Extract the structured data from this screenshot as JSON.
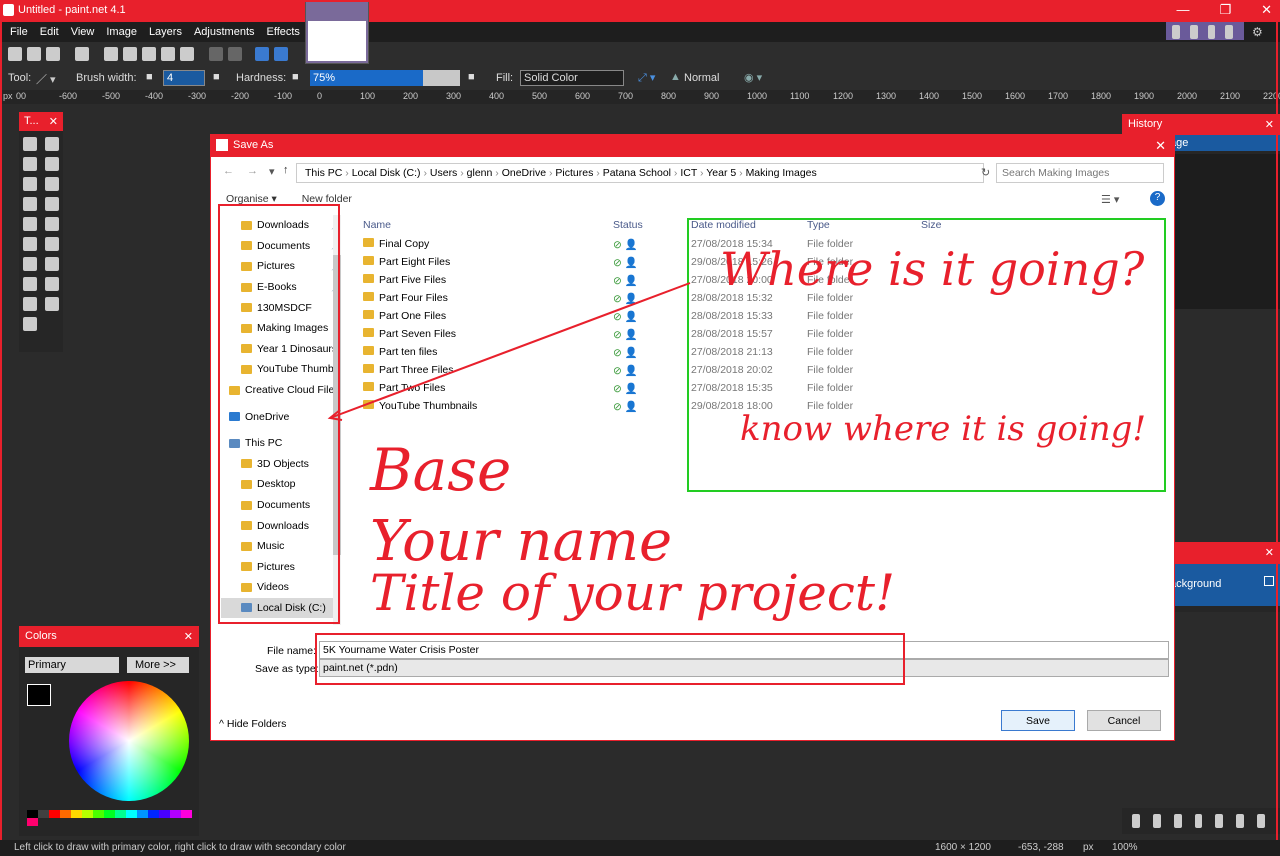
{
  "app": {
    "title": "Untitled - paint.net 4.1"
  },
  "menu": [
    "File",
    "Edit",
    "View",
    "Image",
    "Layers",
    "Adjustments",
    "Effects"
  ],
  "toolbar": {
    "tool_label": "Tool:",
    "brush_width_label": "Brush width:",
    "brush_width": "4",
    "hardness_label": "Hardness:",
    "hardness": "75%",
    "hardness_fraction": 0.75,
    "fill_label": "Fill:",
    "fill_value": "Solid Color",
    "blend_mode": "Normal"
  },
  "ruler": {
    "unit": "px",
    "ticks": [
      "00",
      "-600",
      "-500",
      "-400",
      "-300",
      "-200",
      "-100",
      "0",
      "100",
      "200",
      "300",
      "400",
      "500",
      "600",
      "700",
      "800",
      "900",
      "1000",
      "1100",
      "1200",
      "1300",
      "1400",
      "1500",
      "1600",
      "1700",
      "1800",
      "1900",
      "2000",
      "2100",
      "2200"
    ]
  },
  "tools_panel": {
    "title": "T..."
  },
  "history_panel": {
    "title": "History",
    "item": "age"
  },
  "layers_panel": {
    "item": "ackground"
  },
  "colors_panel": {
    "title": "Colors",
    "mode": "Primary",
    "more_button": "More >>"
  },
  "palette": [
    "#000000",
    "#404040",
    "#ff0000",
    "#ff6a00",
    "#ffd800",
    "#b6ff00",
    "#4cff00",
    "#00ff21",
    "#00ff90",
    "#00ffff",
    "#0094ff",
    "#0026ff",
    "#4800ff",
    "#b200ff",
    "#ff00dc",
    "#ff006e"
  ],
  "dialog": {
    "title": "Save As",
    "address": [
      "This PC",
      "Local Disk (C:)",
      "Users",
      "glenn",
      "OneDrive",
      "Pictures",
      "Patana School",
      "ICT",
      "Year 5",
      "Making Images"
    ],
    "search_placeholder": "Search Making Images",
    "organise": "Organise ▾",
    "new_folder": "New folder",
    "nav_items": [
      {
        "label": "Downloads",
        "pin": true
      },
      {
        "label": "Documents",
        "pin": true
      },
      {
        "label": "Pictures",
        "pin": true
      },
      {
        "label": "E-Books",
        "pin": true
      },
      {
        "label": "130MSDCF"
      },
      {
        "label": "Making Images"
      },
      {
        "label": "Year 1 Dinosaurs"
      },
      {
        "label": "YouTube Thumb"
      },
      {
        "label": "Creative Cloud File"
      },
      {
        "label": "OneDrive"
      },
      {
        "label": "This PC"
      },
      {
        "label": "3D Objects"
      },
      {
        "label": "Desktop"
      },
      {
        "label": "Documents"
      },
      {
        "label": "Downloads"
      },
      {
        "label": "Music"
      },
      {
        "label": "Pictures"
      },
      {
        "label": "Videos"
      },
      {
        "label": "Local Disk (C:)"
      }
    ],
    "columns": [
      "Name",
      "Status",
      "Date modified",
      "Type",
      "Size"
    ],
    "files": [
      {
        "name": "Final Copy",
        "date": "27/08/2018 15:34",
        "type": "File folder"
      },
      {
        "name": "Part Eight Files",
        "date": "29/08/2018 15:26",
        "type": "File folder"
      },
      {
        "name": "Part Five Files",
        "date": "27/08/2018 20:00",
        "type": "File folder"
      },
      {
        "name": "Part Four Files",
        "date": "28/08/2018 15:32",
        "type": "File folder"
      },
      {
        "name": "Part One Files",
        "date": "28/08/2018 15:33",
        "type": "File folder"
      },
      {
        "name": "Part Seven Files",
        "date": "28/08/2018 15:57",
        "type": "File folder"
      },
      {
        "name": "Part ten files",
        "date": "27/08/2018 21:13",
        "type": "File folder"
      },
      {
        "name": "Part Three Files",
        "date": "27/08/2018 20:02",
        "type": "File folder"
      },
      {
        "name": "Part Two Files",
        "date": "27/08/2018 15:35",
        "type": "File folder"
      },
      {
        "name": "YouTube Thumbnails",
        "date": "29/08/2018 18:00",
        "type": "File folder"
      }
    ],
    "file_name_label": "File name:",
    "file_name": "5K Yourname Water Crisis Poster",
    "save_type_label": "Save as type:",
    "save_type": "paint.net (*.pdn)",
    "hide_folders": "Hide Folders",
    "save": "Save",
    "cancel": "Cancel"
  },
  "annotations": [
    "Where is it going?",
    "know where it is going!",
    "Base",
    "Your name",
    "Title of your project!"
  ],
  "status": {
    "text": "Left click to draw with primary color, right click to draw with secondary color",
    "size": "1600 × 1200",
    "coords": "-653, -288",
    "unit": "px",
    "zoom": "100%"
  }
}
